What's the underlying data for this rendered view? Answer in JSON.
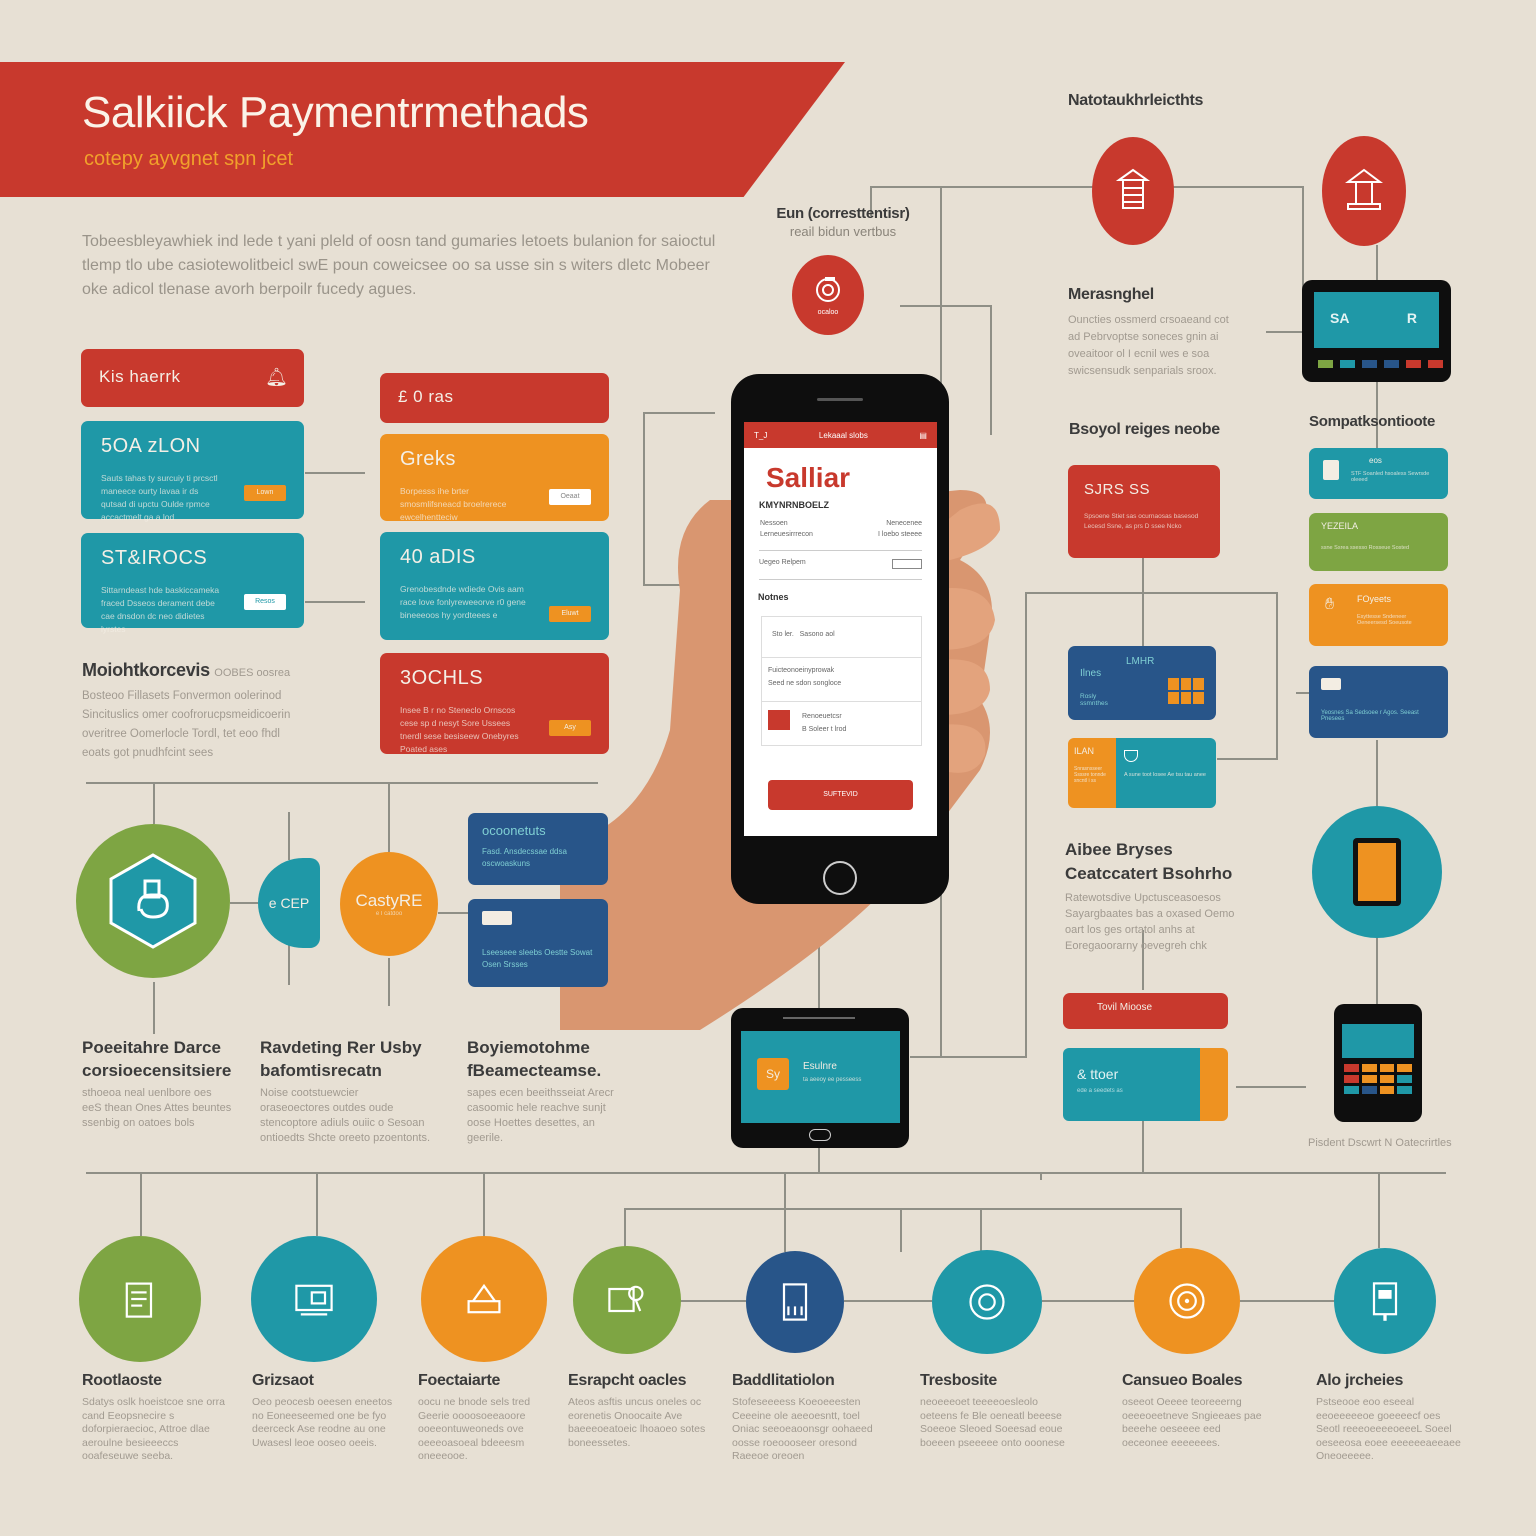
{
  "header": {
    "title": "Salkiick Paymentrmethads",
    "subtitle": "cotepy ayvgnet spn jcet",
    "intro": "Tobeesbleyawhiek ind lede t yani pleld of oosn tand gumaries letoets bulanion for saioctul tlemp tlo ube casiotewolitbeicl swE poun coweicsee oo sa usse sin s witers dletc Mobeer oke adicol tlenase avorh berpoilr fucedy agues."
  },
  "colors": {
    "background": "#e7e0d4",
    "red": "#c8392d",
    "teal": "#1f98a7",
    "orange": "#ee9221",
    "blue": "#285589",
    "green": "#7ea543"
  },
  "left_cards": {
    "header_card": {
      "label": "Kis haerrk",
      "icon": "bell-icon"
    },
    "cards": [
      {
        "title": "5OA zLON",
        "body": "Sauts tahas ty surcuiy ti prcsctl maneece ourty lavaa ir ds qutsad di upctu Oulde rpmce accactmelt ga a lod",
        "button": "Lown",
        "color": "teal"
      },
      {
        "title": "ST&IROCS",
        "body": "Sittarndeast hde baskiccameka fraced Dsseos derament debe cae dnsdon dc neo didietes lyrstes",
        "button": "Resos",
        "color": "teal"
      }
    ],
    "section": {
      "heading": "Moiohtkorcevis",
      "heading_aside": "OOBES oosrea",
      "body": "Bosteoo Fillasets Fonvermon oolerinod Sincituslics omer coofrorucpsmeidicoerin overitree Oomerlocle Tordl, tet eoo fhdl eoats got pnudhfcint sees"
    }
  },
  "middle_cards": {
    "header_card": {
      "label": "£ 0 ras"
    },
    "cards": [
      {
        "title": "Greks",
        "body": "Borpesss ihe brter smosmlifsneacd broelrerece ewcelhentteciw",
        "button": "Oeaat",
        "color": "orange"
      },
      {
        "title": "40 aDIS",
        "body": "Grenobesdnde wdiede Ovis aam race love fonlyreweeorve r0 gene bineeeoos hy yordteees e",
        "button": "Eluwt",
        "color": "teal"
      },
      {
        "title": "3OCHLS",
        "body": "Insee B r no Steneclo Ornscos cese sp d nesyt Sore Ussees tnerdl sese besiseew Onebyres Poated ases",
        "button": "Asy",
        "color": "red"
      }
    ]
  },
  "lower_left": {
    "circles": [
      {
        "label": "",
        "icon": "wallet-hexagon-icon",
        "color": "green"
      },
      {
        "label": "e CEP",
        "color": "teal"
      },
      {
        "label": "CastyRE",
        "sub": "e I catdoo",
        "color": "orange"
      }
    ],
    "blue_cards": [
      {
        "title": "ocoonetuts",
        "body": "Fasd. Ansdecssae ddsa oscwoaskuns"
      },
      {
        "title": "",
        "icon": "wallet-icon",
        "body": "Lseeseee sleebs Oestte Sowat Osen Srsses"
      }
    ],
    "columns": [
      {
        "heading": "Poeeitahre Darce corsioecensitsiere",
        "body": "sthoeoa neal uenlbore oes eeS thean Ones Attes beuntes ssenbig on oatoes bols"
      },
      {
        "heading": "Ravdeting Rer Usby bafomtisrecatn",
        "body": "Noise cootstuewcier oraseoectores outdes oude stencoptore adiuls ouiic o Sesoan ontioedts Shcte oreeto pzoentonts."
      },
      {
        "heading": "Boyiemotohme fBeamecteamse.",
        "body": "sapes ecen beeithsseiat Arecr casoomic hele reachve sunjt oose Hoettes desettes, an geerile."
      }
    ]
  },
  "phone": {
    "status_left": "T_J",
    "status_center": "Lekaaal slobs",
    "app_name": "Salliar",
    "section1": "KMYNRNBOELZ",
    "row1": {
      "left_top": "Nessoen",
      "left_bottom": "Lerneuesirrrecon",
      "right_top": "Nenecenee",
      "right_bottom": "I loebo steeee"
    },
    "row2_label": "Uegeo Relpem",
    "section2": "Notnes",
    "field1": {
      "label": "Sto ler.",
      "value": "Sasono aol"
    },
    "field2": {
      "label": "Fuicteonoeinyprowak",
      "value": "Seed ne sdon songloce"
    },
    "field3": {
      "label": "Renoeuetcsr",
      "value": "B Soleer t lrod"
    },
    "button": "SUFTEVID"
  },
  "right_top": {
    "heading": "Natotaukhrleicthts",
    "left_label": {
      "title": "Eun (corresttentisr)",
      "sub": "reail bidun vertbus"
    },
    "circle_top_left": {
      "icon": "register-icon",
      "text": "ocaloo"
    },
    "circle_top_mid": {
      "icon": "stack-icon"
    },
    "circle_top_right": {
      "icon": "kiosk-icon"
    },
    "mid_section": {
      "heading": "Merasnghel",
      "body": "Ouncties ossmerd crsoaeand cot ad Pebrvoptse soneces gnin ai oveaitoor ol I ecnil wes e soa swicsensudk senparials sroox."
    },
    "terminal": {
      "screen_left": "SA",
      "screen_right": "R"
    }
  },
  "right_flow": {
    "heading": "Bsoyol reiges neobe",
    "red_card": {
      "title": "SJRS SS",
      "body": "Spsoene Stiet sas ocurnaosas basesod Lecesd Ssne, as prs D ssee Ncko"
    },
    "blue_card": {
      "title": "LMHR",
      "sub": "Ilnes",
      "body": "Rosly ssmnthes"
    },
    "split_card": {
      "left_title": "ILAN",
      "left_body": "Snrasnsseer Ssssre tonnde sncntl i ss",
      "right_body": "A sune toot losee Ae tsu tau anee"
    }
  },
  "right_column": {
    "heading": "Sompatksontioote",
    "cards": [
      {
        "title": "eos",
        "body": "STF Soanled hsoaless Sewrsde oleeed",
        "color": "teal"
      },
      {
        "title": "YEZEILA",
        "body": "ssne Ssrea ssesso Rosseue Sosted",
        "color": "green"
      },
      {
        "title": "FOyeets",
        "body": "Esyttesse Sndeneer Oeneersesd Soeusote",
        "color": "orange"
      },
      {
        "title": "",
        "body": "Yeosnes Sa Sedsoee r  Agos. Seeast Pnesees",
        "color": "blue"
      }
    ]
  },
  "right_lower": {
    "section": {
      "heading": "Aibee Bryses Ceatccatert Bsohrho",
      "body": "Ratewotsdive Upctusceasoesos Sayargbaates bas a oxased Oemo oart los ges ortatol anhs at Eoregaoorarny oevegreh chk"
    },
    "red_bar": "Tovil Mioose",
    "teal_card": {
      "title": "& ttoer",
      "sub": "ede a seedets as"
    },
    "tablet": {
      "label": "Esulnre",
      "sub": "ta aeeoy ee pesseess",
      "badge": "Sy"
    },
    "pos_label": "Pisdent Dscwrt N Oatecrirtles"
  },
  "bottom_row": [
    {
      "title": "Rootlaoste",
      "icon": "document-icon",
      "color": "green",
      "body": "Sdatys oslk hoeistcoe sne orra cand Eeopsnecire s doforpieraecioc, Attroe dlae aeroulne besieeeccs ooafeseuwe seeba."
    },
    {
      "title": "Grizsaot",
      "icon": "pos-card-icon",
      "color": "teal",
      "body": "Oeo peocesb oeesen eneetos no Eoneeseemed one be fyo deerceck Ase reodne au one Uwasesl leoe ooseo oeeis."
    },
    {
      "title": "Foectaiarte",
      "icon": "card-reader-icon",
      "color": "orange",
      "body": "oocu ne bnode sels tred Geerie oooosoeeaoore ooeeontuweoneds ove oeeeoasoeal bdeeesm oneeeooe."
    },
    {
      "title": "Esrapcht oacles",
      "icon": "card-tap-icon",
      "color": "green",
      "body": "Ateos asftis uncus oneles oc eorenetis Onoocaite Ave baeeeoeatoeic lhoaoeo sotes boneessetes."
    },
    {
      "title": "Baddlitatiolon",
      "icon": "phone-card-icon",
      "color": "blue",
      "body": "Stofeseeeess Koeoeeesten Ceeeine ole aeeoesntt, toel Oniac seeoeaoonsgr oohaeed oosse roeoooseer oresond Raeeoe oreoen"
    },
    {
      "title": "Tresbosite",
      "icon": "contactless-icon",
      "color": "teal",
      "body": "neoeeeoet teeeeoesleolo oeteens fe Ble oeneatl beeese Soeeoe Sleoed Soeesad eoue boeeen pseeeee onto ooonese"
    },
    {
      "title": "Cansueo Boales",
      "icon": "spiral-icon",
      "color": "orange",
      "body": "oseeot Oeeee teoreeerng oeeeoeetneve Sngieeaes pae beeehe oeseeee eed oeceonee eeeeeees."
    },
    {
      "title": "Alo jrcheies",
      "icon": "terminal-icon",
      "color": "teal",
      "body": "Pstseooe eoo eseeal eeoeeeeeoe goeeeecf oes Seotl reeeoeeeeoeeeL Soeel oeseeosa eoee eeeeeeaeeaee Oneoeeeee."
    }
  ]
}
